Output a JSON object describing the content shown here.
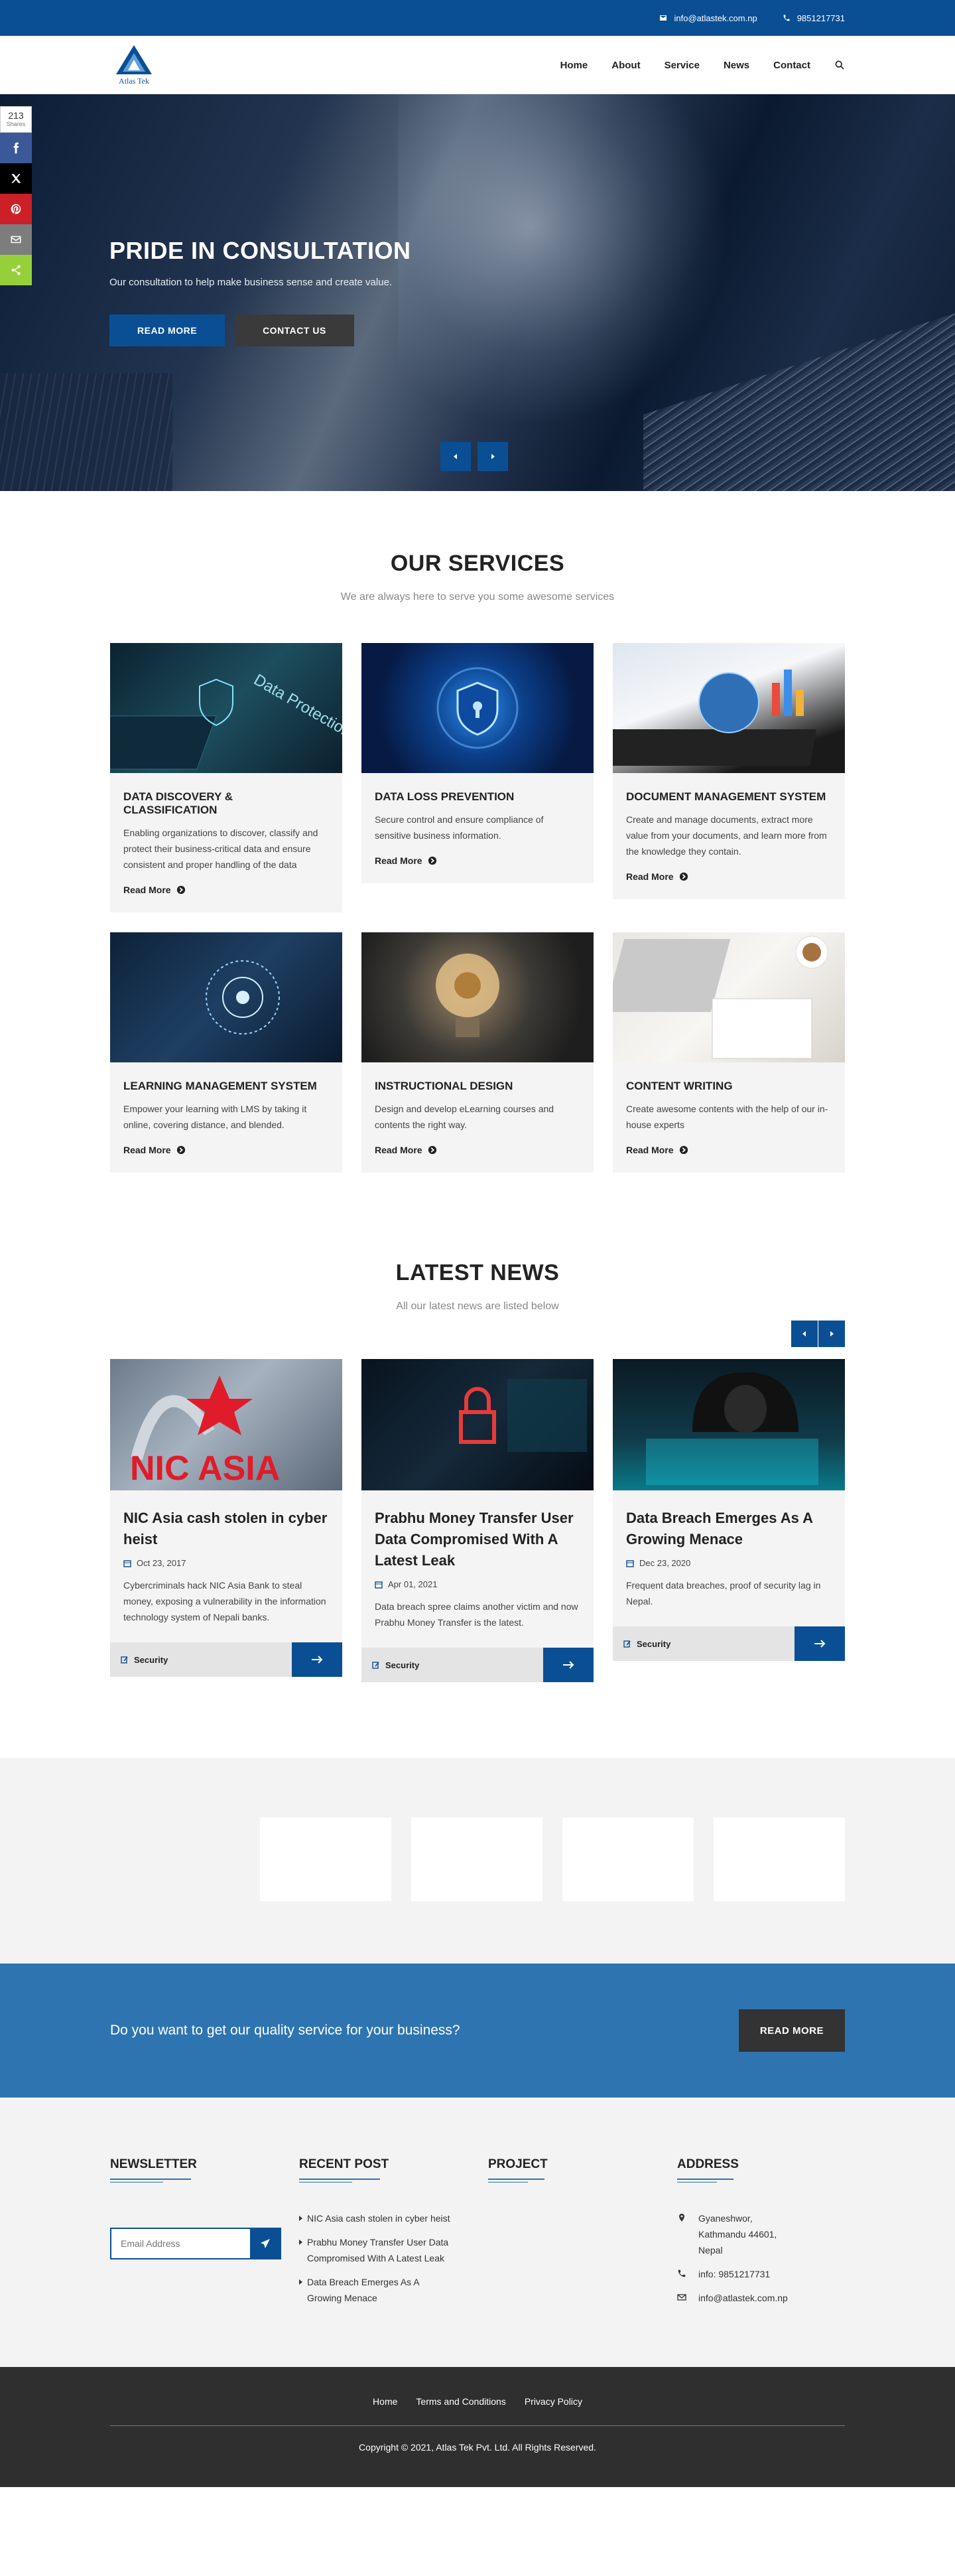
{
  "topbar": {
    "email": "info@atlastek.com.np",
    "phone": "9851217731"
  },
  "logo": {
    "name": "Atlas Tek"
  },
  "nav": {
    "items": [
      "Home",
      "About",
      "Service",
      "News",
      "Contact"
    ]
  },
  "share": {
    "count": "213",
    "label": "Shares"
  },
  "hero": {
    "title": "PRIDE IN CONSULTATION",
    "subtitle": "Our consultation to help make business sense and create value.",
    "read_more": "READ MORE",
    "contact_us": "CONTACT US"
  },
  "services": {
    "title": "OUR SERVICES",
    "subtitle": "We are always here to serve you some awesome services",
    "read_more": "Read More",
    "items": [
      {
        "title": "DATA DISCOVERY & CLASSIFICATION",
        "text": "Enabling organizations to discover, classify and protect their business-critical data and ensure consistent and proper handling of the data",
        "img_text": "Data Protection"
      },
      {
        "title": "DATA LOSS PREVENTION",
        "text": "Secure control and ensure compliance of sensitive business information."
      },
      {
        "title": "DOCUMENT MANAGEMENT SYSTEM",
        "text": "Create and manage documents, extract more value from your documents, and learn more from the knowledge they contain."
      },
      {
        "title": "LEARNING MANAGEMENT SYSTEM",
        "text": "Empower your learning with LMS by taking it online, covering distance, and blended."
      },
      {
        "title": "INSTRUCTIONAL DESIGN",
        "text": "Design and develop eLearning courses and contents the right way."
      },
      {
        "title": "CONTENT WRITING",
        "text": "Create awesome contents with the help of our in-house experts"
      }
    ]
  },
  "news": {
    "title": "LATEST NEWS",
    "subtitle": "All our latest news are listed below",
    "items": [
      {
        "title": "NIC Asia cash stolen in cyber heist",
        "date": "Oct 23, 2017",
        "text": "Cybercriminals hack NIC Asia Bank to steal money, exposing a vulnerability in the information technology system of Nepali banks.",
        "category": "Security",
        "img_text": "NIC ASIA"
      },
      {
        "title": "Prabhu Money Transfer User Data Compromised With A Latest Leak",
        "date": "Apr 01, 2021",
        "text": "Data breach spree claims another victim and now Prabhu Money Transfer is the latest.",
        "category": "Security"
      },
      {
        "title": "Data Breach Emerges As A Growing Menace",
        "date": "Dec 23, 2020",
        "text": "Frequent data breaches, proof of security lag in Nepal.",
        "category": "Security"
      }
    ]
  },
  "cta": {
    "text": "Do you want to get our quality service for your business?",
    "button": "READ MORE"
  },
  "footer": {
    "newsletter": {
      "title": "NEWSLETTER",
      "placeholder": "Email Address"
    },
    "recent": {
      "title": "RECENT POST",
      "items": [
        "NIC Asia cash stolen in cyber heist",
        "Prabhu Money Transfer User Data Compromised With A Latest Leak",
        "Data Breach Emerges As A Growing Menace"
      ]
    },
    "project": {
      "title": "PROJECT"
    },
    "address": {
      "title": "ADDRESS",
      "location": "Gyaneshwor, Kathmandu 44601, Nepal",
      "phone": "info: 9851217731",
      "email": "info@atlastek.com.np"
    }
  },
  "bottom": {
    "links": [
      "Home",
      "Terms and Conditions",
      "Privacy Policy"
    ],
    "copyright": "Copyright © 2021, Atlas Tek Pvt. Ltd. All Rights Reserved."
  },
  "colors": {
    "primary": "#0a4f94",
    "cta": "#2e74b0",
    "dark": "#2f2f2f",
    "facebook": "#3b5998",
    "twitter": "#000000",
    "pinterest": "#cb2027",
    "email": "#7d7d7d",
    "sharethis": "#95d03a"
  }
}
